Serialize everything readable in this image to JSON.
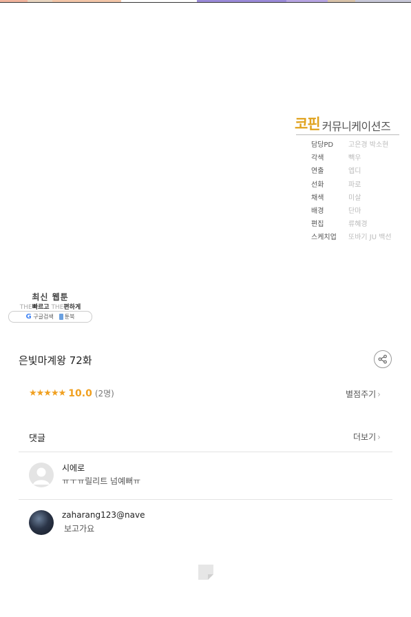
{
  "top_strip_colors": [
    "#f1b49d",
    "#e8d5c0",
    "#f3c6a8",
    "#ffffff",
    "#9a8ad8",
    "#b7a4e2",
    "#d8c2a8",
    "#c8c8d8"
  ],
  "credits": {
    "brand_main": "코핀",
    "brand_sub": "커뮤니케이션즈",
    "rows": [
      {
        "role": "담당PD",
        "name": "고은경 박소현"
      },
      {
        "role": "각색",
        "name": "빽우"
      },
      {
        "role": "연출",
        "name": "엡디"
      },
      {
        "role": "선화",
        "name": "파로"
      },
      {
        "role": "채색",
        "name": "미살"
      },
      {
        "role": "배경",
        "name": "단마"
      },
      {
        "role": "편집",
        "name": "류혜경"
      },
      {
        "role": "스케치업",
        "name": "또바기 JU 백선"
      }
    ]
  },
  "ad": {
    "title": "최신 웹툰",
    "sub_the1": "THE",
    "sub_fast": "빠르고",
    "sub_the2": "THE",
    "sub_easy": "편하게",
    "google_icon": "google-g-icon",
    "google_label": "구글검색",
    "book_icon": "book-icon",
    "book_label": "툰북"
  },
  "episode": {
    "title": "은빛마계왕 72화"
  },
  "rating": {
    "stars": "★★★★★",
    "score": "10.0",
    "count": "(2명)",
    "rate_link": "별점주기"
  },
  "comments": {
    "label": "댓글",
    "more": "더보기",
    "chevron": "›",
    "items": [
      {
        "author": "시에로",
        "text": "ㅠㅜㅠ릴리트 넘예뻐ㅠ"
      },
      {
        "author": "zaharang123@nave",
        "text": "보고가요"
      }
    ]
  }
}
